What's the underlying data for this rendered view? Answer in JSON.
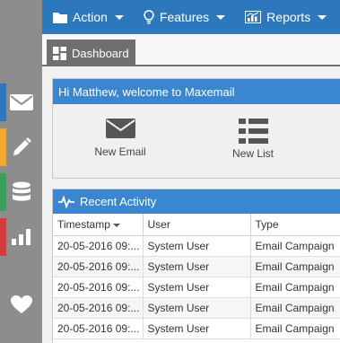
{
  "sidebar": {
    "items": [
      {
        "icon": "envelope-icon",
        "accent": "#2d78bd"
      },
      {
        "icon": "pencil-icon",
        "accent": "#f0a830"
      },
      {
        "icon": "database-icon",
        "accent": "#3aa05a"
      },
      {
        "icon": "bar-chart-icon",
        "accent": "#d43a3a"
      },
      {
        "icon": "heart-icon",
        "accent": ""
      }
    ]
  },
  "topbar": {
    "menus": [
      {
        "label": "Action",
        "icon": "folder-icon"
      },
      {
        "label": "Features",
        "icon": "lightbulb-icon"
      },
      {
        "label": "Reports",
        "icon": "chart-icon"
      }
    ]
  },
  "tabs": {
    "dashboard": "Dashboard"
  },
  "welcome": {
    "title": "Hi Matthew, welcome to Maxemail",
    "actions": [
      {
        "label": "New Email",
        "icon": "envelope-icon"
      },
      {
        "label": "New List",
        "icon": "list-icon"
      }
    ]
  },
  "activity": {
    "title": "Recent Activity",
    "columns": [
      "Timestamp",
      "User",
      "Type"
    ],
    "rows": [
      [
        "20-05-2016 09:...",
        "System User",
        "Email Campaign"
      ],
      [
        "20-05-2016 09:...",
        "System User",
        "Email Campaign"
      ],
      [
        "20-05-2016 09:...",
        "System User",
        "Email Campaign"
      ],
      [
        "20-05-2016 09:...",
        "System User",
        "Email Campaign"
      ],
      [
        "20-05-2016 09:...",
        "System User",
        "Email Campaign"
      ]
    ]
  },
  "colors": {
    "topbar": "#2d78bd",
    "panel_header": "#3a87cf",
    "sidebar": "#8d8d8d"
  }
}
